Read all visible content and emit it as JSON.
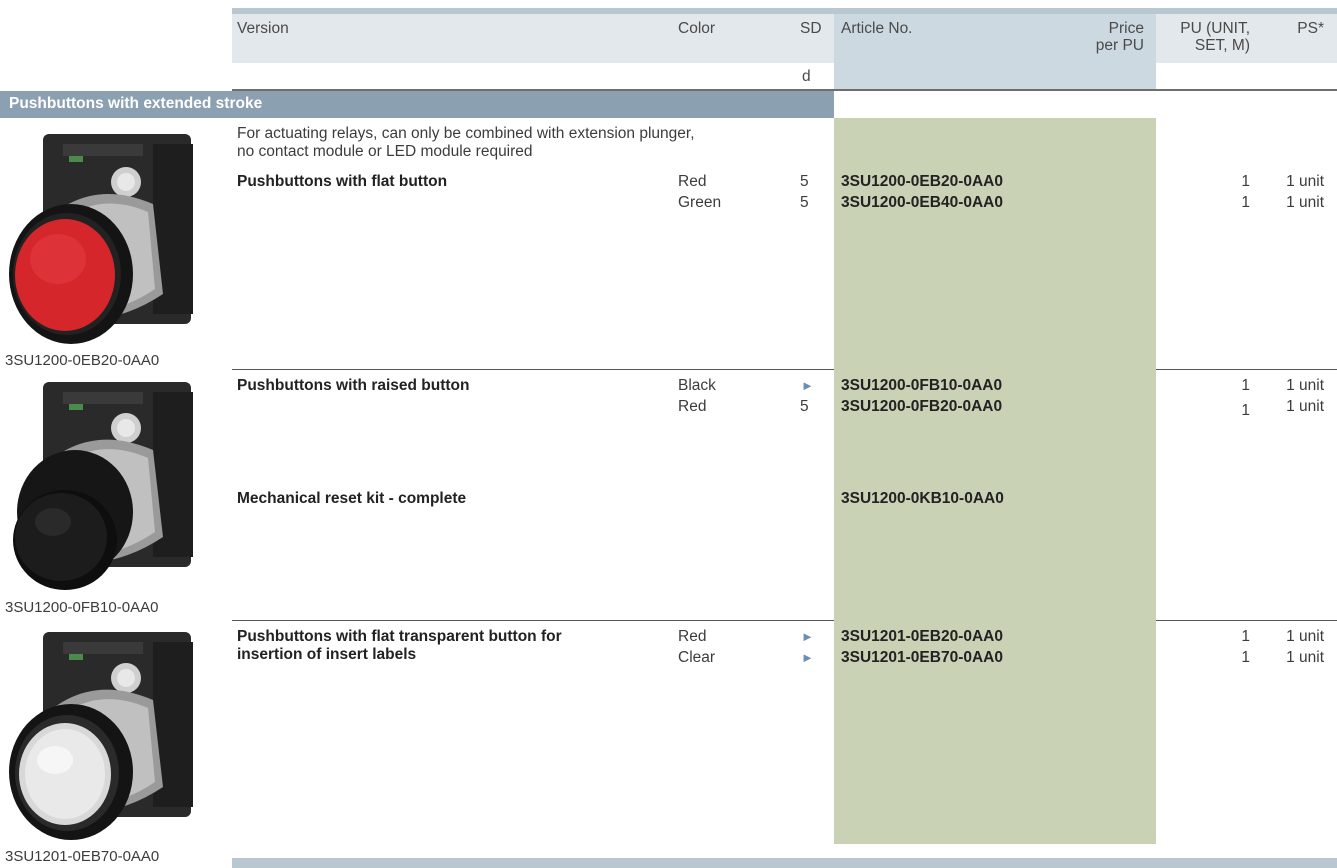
{
  "header": {
    "version": "Version",
    "color": "Color",
    "sd": "SD",
    "sd_sub": "d",
    "article": "Article No.",
    "price": "Price\nper PU",
    "pu": "PU (UNIT,\nSET, M)",
    "ps": "PS*"
  },
  "section_title": "Pushbuttons with extended stroke",
  "intro": "For actuating relays, can only be combined with extension plunger,\nno contact module or LED module required",
  "groups": [
    {
      "label": "Pushbuttons with flat button",
      "photo_caption": "3SU1200-0EB20-0AA0",
      "photo_icon": "red-pushbutton-image",
      "rows": [
        {
          "color": "Red",
          "sd": "5",
          "article": "3SU1200-0EB20-0AA0",
          "pu": "1",
          "ps": "1 unit"
        },
        {
          "color": "Green",
          "sd": "5",
          "article": "3SU1200-0EB40-0AA0",
          "pu": "1",
          "ps": "1 unit"
        }
      ]
    },
    {
      "label": "Pushbuttons with raised button",
      "photo_caption": "3SU1200-0FB10-0AA0",
      "photo_icon": "black-pushbutton-image",
      "rows": [
        {
          "color": "Black",
          "sd": "►",
          "article": "3SU1200-0FB10-0AA0",
          "pu": "1",
          "ps": "1 unit"
        },
        {
          "color": "Red",
          "sd": "5",
          "article": "3SU1200-0FB20-0AA0",
          "pu": "1",
          "ps": "1 unit"
        }
      ],
      "extra_label": "Mechanical reset kit - complete",
      "extra_article": "3SU1200-0KB10-0AA0"
    },
    {
      "label": "Pushbuttons with flat transparent button for\ninsertion of insert labels",
      "photo_caption": "3SU1201-0EB70-0AA0",
      "photo_icon": "clear-pushbutton-image",
      "rows": [
        {
          "color": "Red",
          "sd": "►",
          "article": "3SU1201-0EB20-0AA0",
          "pu": "1",
          "ps": "1 unit"
        },
        {
          "color": "Clear",
          "sd": "►",
          "article": "3SU1201-0EB70-0AA0",
          "pu": "1",
          "ps": "1 unit"
        }
      ]
    }
  ],
  "colors": {
    "header_bg": "#e2e8ec",
    "header_top_rule": "#b9c7d1",
    "article_header_bg": "#cdd9e1",
    "article_col_bg": "#c9d2b5",
    "section_bar": "#8ba0b1",
    "arrow": "#6d8fb3"
  }
}
